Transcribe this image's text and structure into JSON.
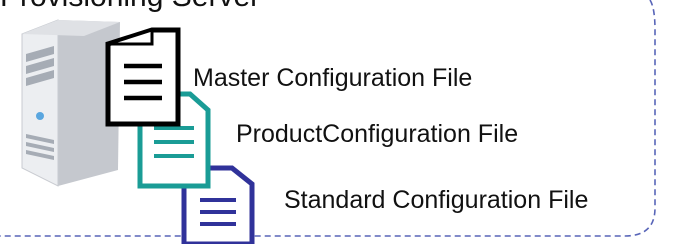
{
  "diagram": {
    "title": "Provisioning Server",
    "icons": {
      "server": "server-tower-icon",
      "file": "document-icon"
    },
    "files": [
      {
        "label": "Master Configuration File",
        "color": "#000000"
      },
      {
        "label": "ProductConfiguration File",
        "color": "#1a9c96"
      },
      {
        "label": "Standard Configuration File",
        "color": "#30329a"
      }
    ],
    "colors": {
      "border": "#5865b8",
      "server_body": "#d7d9de",
      "server_front": "#c8cbd1",
      "server_accent": "#9aa2ad"
    }
  }
}
